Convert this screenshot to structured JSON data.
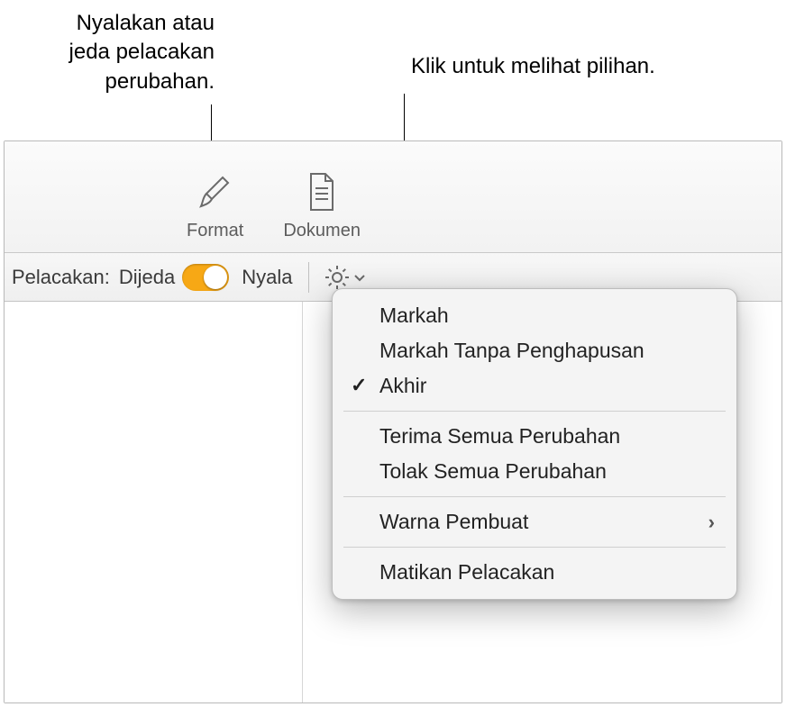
{
  "callouts": {
    "left_text": "Nyalakan atau jeda pelacakan perubahan.",
    "right_text": "Klik untuk melihat pilihan."
  },
  "toolbar": {
    "format_label": "Format",
    "document_label": "Dokumen"
  },
  "tracking_bar": {
    "label": "Pelacakan:",
    "status_paused": "Dijeda",
    "status_on": "Nyala"
  },
  "menu": {
    "markup": "Markah",
    "markup_no_deletions": "Markah Tanpa Penghapusan",
    "final": "Akhir",
    "accept_all": "Terima Semua Perubahan",
    "reject_all": "Tolak Semua Perubahan",
    "author_color": "Warna Pembuat",
    "turn_off": "Matikan Pelacakan",
    "selected": "final"
  },
  "icons": {
    "format": "paintbrush-icon",
    "document": "document-icon",
    "gear": "gear-icon",
    "chevron_down": "chevron-down-icon",
    "chevron_right": "chevron-right-icon",
    "checkmark": "checkmark-icon"
  },
  "colors": {
    "toggle_accent": "#f7a815"
  }
}
